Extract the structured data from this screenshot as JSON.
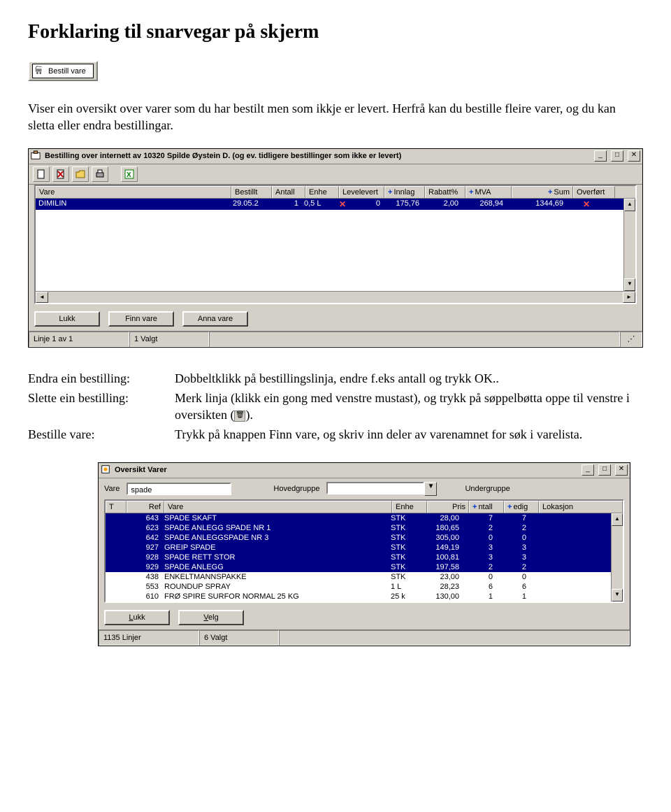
{
  "doc": {
    "title": "Forklaring til snarvegar på skjerm",
    "demo_button": "Bestill vare",
    "intro": "Viser ein oversikt over varer som du har bestilt men som ikkje er levert. Herfrå kan du bestille fleire varer, og du kan sletta eller endra bestillingar."
  },
  "win1": {
    "title": "Bestilling over internett av 10320  Spilde Øystein D. (og ev. tidligere bestillinger som ikke er levert)",
    "columns": [
      "Vare",
      "Bestillt",
      "Antall",
      "Enhe",
      "Levelevert",
      "Innlag",
      "Rabatt%",
      "MVA",
      "Sum",
      "Overført"
    ],
    "row": {
      "vare": "DIMILIN",
      "bestillt": "29.05.2",
      "antall": "1",
      "enhet": "0,5 L",
      "levert_mark": "✕",
      "innlag": "0",
      "pris": "175,76",
      "rabatt": "2,00",
      "mva": "268,94",
      "sum": "1344,69",
      "overfort_mark": "✕"
    },
    "buttons": {
      "lukk": "Lukk",
      "finn": "Finn vare",
      "anna": "Anna vare"
    },
    "status": {
      "left": "Linje 1 av 1",
      "sel": "1 Valgt"
    }
  },
  "defs": {
    "r1_term": "Endra ein bestilling:",
    "r1_def": "Dobbeltklikk på bestillingslinja, endre f.eks antall og trykk OK..",
    "r2_term": "Slette ein bestilling:",
    "r2_def_a": "Merk linja (klikk ein gong med venstre mustast), og trykk på søppelbøtta oppe til venstre i oversikten (",
    "r2_def_b": ").",
    "r3_term": "Bestille vare:",
    "r3_def": " Trykk på knappen Finn vare, og skriv inn deler av varenamnet for søk i varelista."
  },
  "win2": {
    "title": "Oversikt Varer",
    "labels": {
      "vare": "Vare",
      "hoved": "Hovedgruppe",
      "under": "Undergruppe"
    },
    "search_value": "spade",
    "columns": [
      "T",
      "Ref",
      "Vare",
      "Enhe",
      "Pris",
      "ntall",
      "edig",
      "Lokasjon"
    ],
    "rows": [
      {
        "t": "",
        "ref": "643",
        "vare": "SPADE SKAFT",
        "enhet": "STK",
        "pris": "28,00",
        "antall": "7",
        "ledig": "7",
        "lok": ""
      },
      {
        "t": "",
        "ref": "623",
        "vare": "SPADE ANLEGG SPADE NR 1",
        "enhet": "STK",
        "pris": "180,65",
        "antall": "2",
        "ledig": "2",
        "lok": ""
      },
      {
        "t": "",
        "ref": "642",
        "vare": "SPADE ANLEGGSPADE NR 3",
        "enhet": "STK",
        "pris": "305,00",
        "antall": "0",
        "ledig": "0",
        "lok": ""
      },
      {
        "t": "",
        "ref": "927",
        "vare": "GREIP SPADE",
        "enhet": "STK",
        "pris": "149,19",
        "antall": "3",
        "ledig": "3",
        "lok": ""
      },
      {
        "t": "",
        "ref": "928",
        "vare": "SPADE RETT STOR",
        "enhet": "STK",
        "pris": "100,81",
        "antall": "3",
        "ledig": "3",
        "lok": ""
      },
      {
        "t": "",
        "ref": "929",
        "vare": "SPADE ANLEGG",
        "enhet": "STK",
        "pris": "197,58",
        "antall": "2",
        "ledig": "2",
        "lok": ""
      },
      {
        "t": "",
        "ref": "438",
        "vare": "ENKELTMANNSPAKKE",
        "enhet": "STK",
        "pris": "23,00",
        "antall": "0",
        "ledig": "0",
        "lok": ""
      },
      {
        "t": "",
        "ref": "553",
        "vare": "ROUNDUP SPRAY",
        "enhet": "1 L",
        "pris": "28,23",
        "antall": "6",
        "ledig": "6",
        "lok": ""
      },
      {
        "t": "",
        "ref": "610",
        "vare": "FRØ SPIRE SURFOR NORMAL 25 KG",
        "enhet": "25 k",
        "pris": "130,00",
        "antall": "1",
        "ledig": "1",
        "lok": ""
      }
    ],
    "selected_indices": [
      0,
      1,
      2,
      3,
      4,
      5
    ],
    "buttons": {
      "lukk": "Lukk",
      "velg": "Velg"
    },
    "status": {
      "left": "1135 Linjer",
      "sel": "6 Valgt"
    }
  }
}
